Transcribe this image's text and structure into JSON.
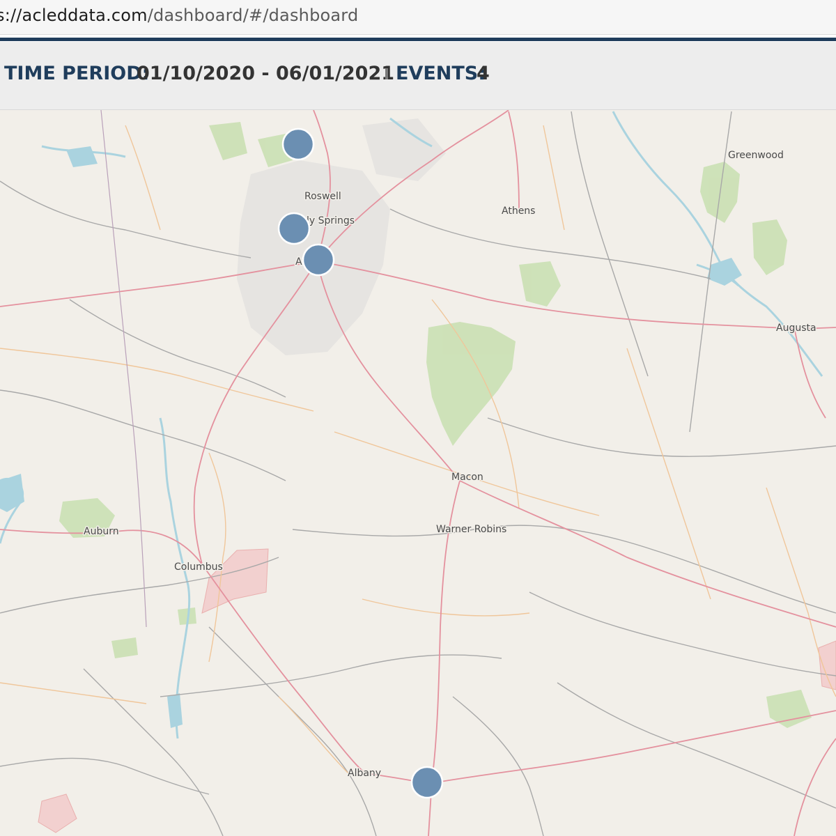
{
  "browser": {
    "url_host": "s://acleddata.com",
    "url_path": "/dashboard/#/dashboard"
  },
  "header": {
    "time_period_label": "TIME PERIOD:",
    "time_period_value": "01/10/2020 - 06/01/2021",
    "events_label": "EVENTS:",
    "events_value": "4"
  },
  "map": {
    "cities": {
      "greenwood": "Greenwood",
      "roswell": "Roswell",
      "athens": "Athens",
      "sandy_springs": "ly Springs",
      "atlanta": "Atlanta",
      "augusta": "Augusta",
      "macon": "Macon",
      "warner_robins": "Warner Robins",
      "auburn": "Auburn",
      "columbus": "Columbus",
      "albany": "Albany"
    },
    "marker_color": "#6b8fb2",
    "road_colors": {
      "major": "#e4919e",
      "secondary": "#f0c69a",
      "minor": "#a8a8a8"
    },
    "water_color": "#aad3df",
    "park_color": "#c8dfb0"
  }
}
